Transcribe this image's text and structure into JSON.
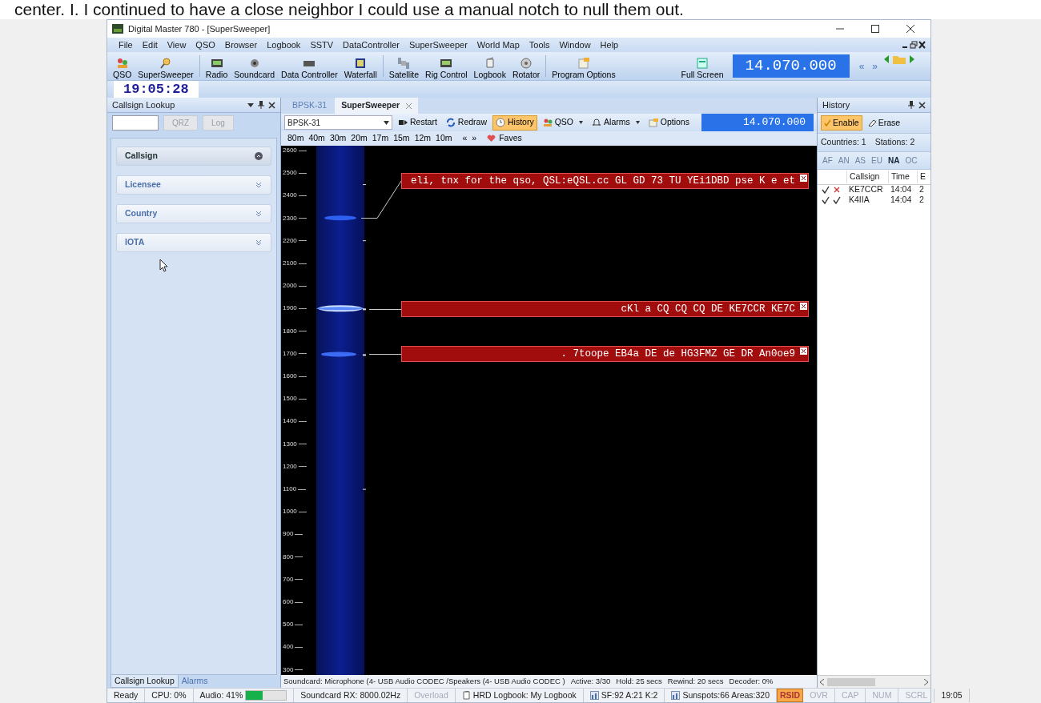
{
  "caption": "center. I. I continued to have a close neighbor I could use a manual notch to null them out.",
  "window": {
    "title": "Digital Master 780 - [SuperSweeper]"
  },
  "menu": [
    "File",
    "Edit",
    "View",
    "QSO",
    "Browser",
    "Logbook",
    "SSTV",
    "DataController",
    "SuperSweeper",
    "World Map",
    "Tools",
    "Window",
    "Help"
  ],
  "toolbar": [
    "QSO",
    "SuperSweeper",
    "Radio",
    "Soundcard",
    "Data Controller",
    "Waterfall",
    "Satellite",
    "Rig Control",
    "Logbook",
    "Rotator",
    "Program Options"
  ],
  "full_screen": "Full Screen",
  "frequency": "14.070.000",
  "freq_nav": [
    "«",
    "»"
  ],
  "clock": "19:05:28",
  "lookup_panel": {
    "title": "Callsign Lookup",
    "buttons": [
      {
        "label": "QRZ",
        "disabled": true
      },
      {
        "label": "Log",
        "disabled": true
      }
    ],
    "sections": [
      {
        "label": "Callsign",
        "expanded": true
      },
      {
        "label": "Licensee",
        "expanded": false
      },
      {
        "label": "Country",
        "expanded": false
      },
      {
        "label": "IOTA",
        "expanded": false
      }
    ],
    "tabs": [
      {
        "label": "Callsign Lookup",
        "selected": true
      },
      {
        "label": "Alarms",
        "selected": false
      }
    ]
  },
  "doc_tabs": [
    {
      "label": "BPSK-31",
      "selected": false
    },
    {
      "label": "SuperSweeper",
      "selected": true
    }
  ],
  "sweeper_toolbar": {
    "mode": "BPSK-31",
    "buttons": [
      {
        "label": "Restart",
        "active": false,
        "dropdown": false
      },
      {
        "label": "Redraw",
        "active": false,
        "dropdown": false
      },
      {
        "label": "History",
        "active": true,
        "dropdown": false
      },
      {
        "label": "QSO",
        "active": false,
        "dropdown": true
      },
      {
        "label": "Alarms",
        "active": false,
        "dropdown": true
      },
      {
        "label": "Options",
        "active": false,
        "dropdown": false
      }
    ],
    "frequency": "14.070.000"
  },
  "bands": [
    "80m",
    "40m",
    "30m",
    "20m",
    "17m",
    "15m",
    "12m",
    "10m"
  ],
  "band_nav": [
    "«",
    "»"
  ],
  "faves": "Faves",
  "waterfall": {
    "freq_labels": [
      "2600",
      "2500",
      "2400",
      "2300",
      "2200",
      "2100",
      "2000",
      "1900",
      "1800",
      "1700",
      "1600",
      "1500",
      "1400",
      "1300",
      "1200",
      "1100",
      "1000",
      "900",
      "800",
      "700",
      "600",
      "500",
      "400",
      "300"
    ],
    "decodes": [
      {
        "text": "eli, tnx for the qso, QSL:eQSL.cc GL GD 73 TU YEi1DBD pse K e et"
      },
      {
        "text": "cKl a CQ CQ CQ DE KE7CCR KE7C"
      },
      {
        "text": ". 7toope EB4a DE de HG3FMZ GE DR An0oe9"
      }
    ]
  },
  "sweeper_status": [
    "Soundcard: Microphone (4- USB Audio CODEC /Speakers (4- USB Audio CODEC )",
    "Active: 3/30",
    "Hold: 25 secs",
    "Rewind: 20 secs",
    "Decoder: 0%"
  ],
  "history": {
    "title": "History",
    "enable": {
      "label": "Enable",
      "selected": true
    },
    "erase": "Erase",
    "countries": "Countries: 1",
    "stations": "Stations: 2",
    "continents": [
      {
        "label": "AF",
        "active": false
      },
      {
        "label": "AN",
        "active": false
      },
      {
        "label": "AS",
        "active": false
      },
      {
        "label": "EU",
        "active": false
      },
      {
        "label": "NA",
        "active": true
      },
      {
        "label": "OC",
        "active": false
      }
    ],
    "columns": [
      "Callsign",
      "Time",
      "E"
    ],
    "rows": [
      {
        "first_check": true,
        "second_check": false,
        "callsign": "KE7CCR",
        "time": "14:04",
        "column_3": "2"
      },
      {
        "first_check": true,
        "second_check": true,
        "callsign": "K4IIA",
        "time": "14:04",
        "column_3": "2"
      }
    ]
  },
  "status_bar": [
    {
      "kind": "text",
      "text": "Ready"
    },
    {
      "kind": "text",
      "text": "CPU: 0%"
    },
    {
      "kind": "meter",
      "text": "Audio: 41%",
      "level": 0.41
    },
    {
      "kind": "text",
      "text": "Soundcard RX: 8000.02Hz"
    },
    {
      "kind": "flag",
      "text": "Overload",
      "on": false
    },
    {
      "kind": "logbook",
      "text": "HRD Logbook: My Logbook"
    },
    {
      "kind": "solar",
      "text": "SF:92 A:21 K:2"
    },
    {
      "kind": "solar",
      "text": "Sunspots:66 Areas:320"
    },
    {
      "kind": "flag",
      "text": "RSID",
      "on": true
    },
    {
      "kind": "flag",
      "text": "OVR",
      "on": false
    },
    {
      "kind": "flag",
      "text": "CAP",
      "on": false
    },
    {
      "kind": "flag",
      "text": "NUM",
      "on": false
    },
    {
      "kind": "flag",
      "text": "SCRL",
      "on": false
    },
    {
      "kind": "text",
      "text": "19:05"
    }
  ]
}
